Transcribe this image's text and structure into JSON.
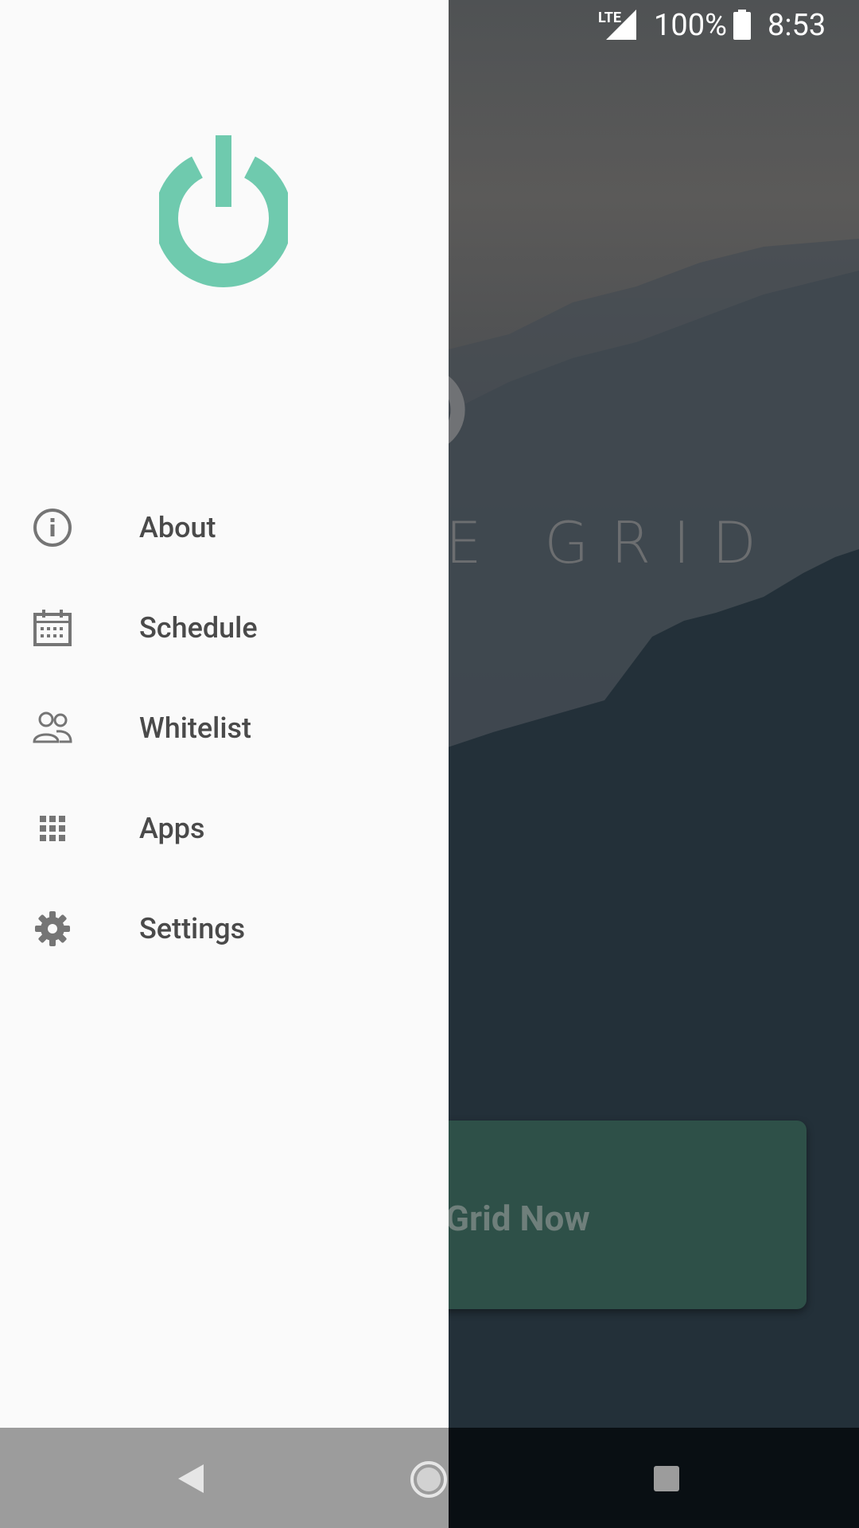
{
  "status_bar": {
    "network": "LTE",
    "battery": "100%",
    "time": "8:53"
  },
  "drawer": {
    "items": [
      {
        "label": "About",
        "icon": "info-icon"
      },
      {
        "label": "Schedule",
        "icon": "calendar-icon"
      },
      {
        "label": "Whitelist",
        "icon": "people-icon"
      },
      {
        "label": "Apps",
        "icon": "apps-grid-icon"
      },
      {
        "label": "Settings",
        "icon": "gear-icon"
      }
    ]
  },
  "background": {
    "title_fragment": "E GRID",
    "button_label": "Grid Now"
  },
  "colors": {
    "accent": "#6fcaae",
    "drawer_bg": "#fafafa",
    "menu_text": "#4a4a4a",
    "icon_gray": "#757575"
  }
}
